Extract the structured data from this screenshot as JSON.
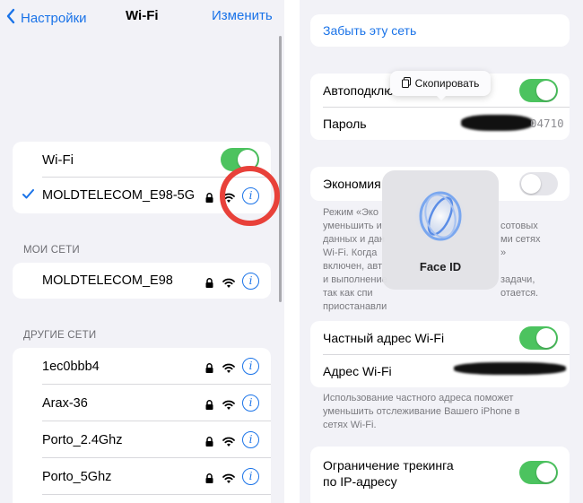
{
  "left": {
    "nav": {
      "back_label": "Настройки",
      "title": "Wi-Fi",
      "edit_label": "Изменить"
    },
    "wifi_toggle": {
      "label": "Wi-Fi",
      "on": true
    },
    "connected_network": {
      "name": "MOLDTELECOM_E98-5G"
    },
    "my_networks": {
      "header": "МОИ СЕТИ",
      "items": [
        {
          "name": "MOLDTELECOM_E98"
        }
      ]
    },
    "other_networks": {
      "header": "ДРУГИЕ СЕТИ",
      "items": [
        {
          "name": "1ec0bbb4"
        },
        {
          "name": "Arax-36"
        },
        {
          "name": "Porto_2.4Ghz"
        },
        {
          "name": "Porto_5Ghz"
        }
      ]
    },
    "highlight_color": "#e8413a"
  },
  "right": {
    "forget_network": "Забыть эту сеть",
    "auto_join": {
      "label": "Автоподключение",
      "on": true
    },
    "password": {
      "label": "Пароль",
      "value_visible": "04710"
    },
    "copy_popup": "Скопировать",
    "low_data": {
      "label": "Экономия",
      "on": false
    },
    "low_data_footer": [
      "Режим «Эко",
      "уменьшить и",
      "данных и дан",
      "Wi-Fi. Когда",
      "включен, авт",
      "и выполнение",
      "так как спи",
      "приостанавли"
    ],
    "low_data_footer_right": [
      "сотовых",
      "ми сетях",
      "»",
      "",
      "задачи,",
      "отается."
    ],
    "face_id": {
      "label": "Face ID"
    },
    "private_address": {
      "label": "Частный адрес Wi-Fi",
      "on": true
    },
    "wifi_address": {
      "label": "Адрес Wi-Fi"
    },
    "private_footer": "Использование частного адреса поможет уменьшить отслеживание Вашего iPhone в сетях Wi-Fi.",
    "ip_tracking": {
      "label_line1": "Ограничение трекинга",
      "label_line2": "по IP-адресу",
      "on": true
    }
  },
  "colors": {
    "accent": "#1a73e8",
    "toggle_on": "#4cc35f",
    "background": "#f2f2f7"
  }
}
